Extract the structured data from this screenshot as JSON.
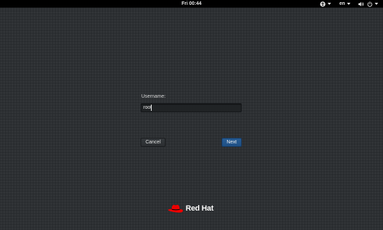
{
  "top_bar": {
    "clock": "Fri 00:44",
    "language": "en",
    "icons": [
      "accessibility-icon",
      "chevron-down-icon",
      "chevron-down-icon",
      "volume-icon",
      "power-icon",
      "chevron-down-icon"
    ]
  },
  "login": {
    "username_label": "Username:",
    "username_value": "root",
    "cancel_label": "Cancel",
    "next_label": "Next"
  },
  "branding": {
    "logo_text": "Red Hat",
    "logo_color": "#ee0000"
  },
  "colors": {
    "background": "#2d3033",
    "top_bar": "#000000",
    "next_button": "#215486"
  }
}
